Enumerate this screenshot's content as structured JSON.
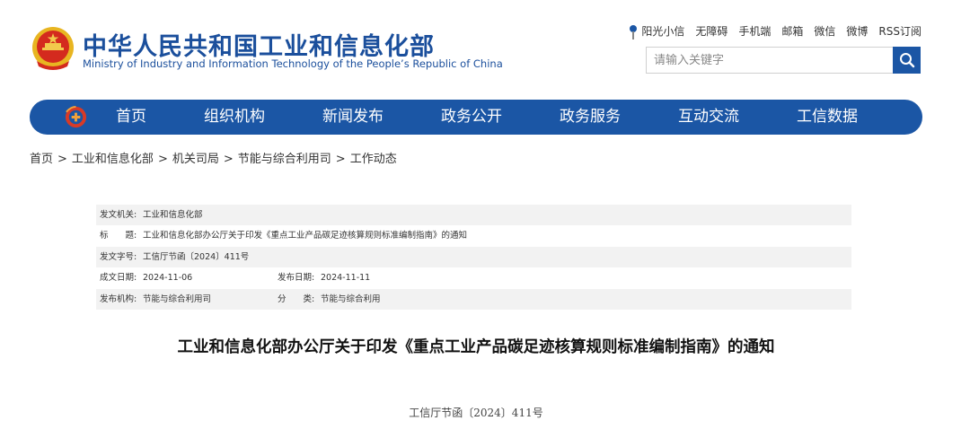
{
  "header": {
    "title": "中华人民共和国工业和信息化部",
    "subtitle": "Ministry of Industry and Information Technology of the People’s Republic of China"
  },
  "top_links": [
    "阳光小信",
    "无障碍",
    "手机端",
    "邮箱",
    "微信",
    "微博",
    "RSS订阅"
  ],
  "search": {
    "placeholder": "请输入关键字"
  },
  "nav": [
    "首页",
    "组织机构",
    "新闻发布",
    "政务公开",
    "政务服务",
    "互动交流",
    "工信数据"
  ],
  "breadcrumb": [
    "首页",
    "工业和信息化部",
    "机关司局",
    "节能与综合利用司",
    "工作动态"
  ],
  "breadcrumb_separator": ">",
  "meta": {
    "issuer_label": "发文机关:",
    "issuer": "工业和信息化部",
    "title_label": "标　　题:",
    "title": "工业和信息化部办公厅关于印发《重点工业产品碳足迹核算规则标准编制指南》的通知",
    "doc_no_label": "发文字号:",
    "doc_no": "工信厅节函〔2024〕411号",
    "created_label": "成文日期:",
    "created": "2024-11-06",
    "published_label": "发布日期:",
    "published": "2024-11-11",
    "org_label": "发布机构:",
    "org": "节能与综合利用司",
    "category_label": "分　　类:",
    "category": "节能与综合利用"
  },
  "article": {
    "title": "工业和信息化部办公厅关于印发《重点工业产品碳足迹核算规则标准编制指南》的通知",
    "doc_number": "工信厅节函〔2024〕411号"
  },
  "colors": {
    "brand_blue": "#1b56a5",
    "title_blue": "#1b4f9c",
    "row_gray": "#f2f2f2"
  }
}
